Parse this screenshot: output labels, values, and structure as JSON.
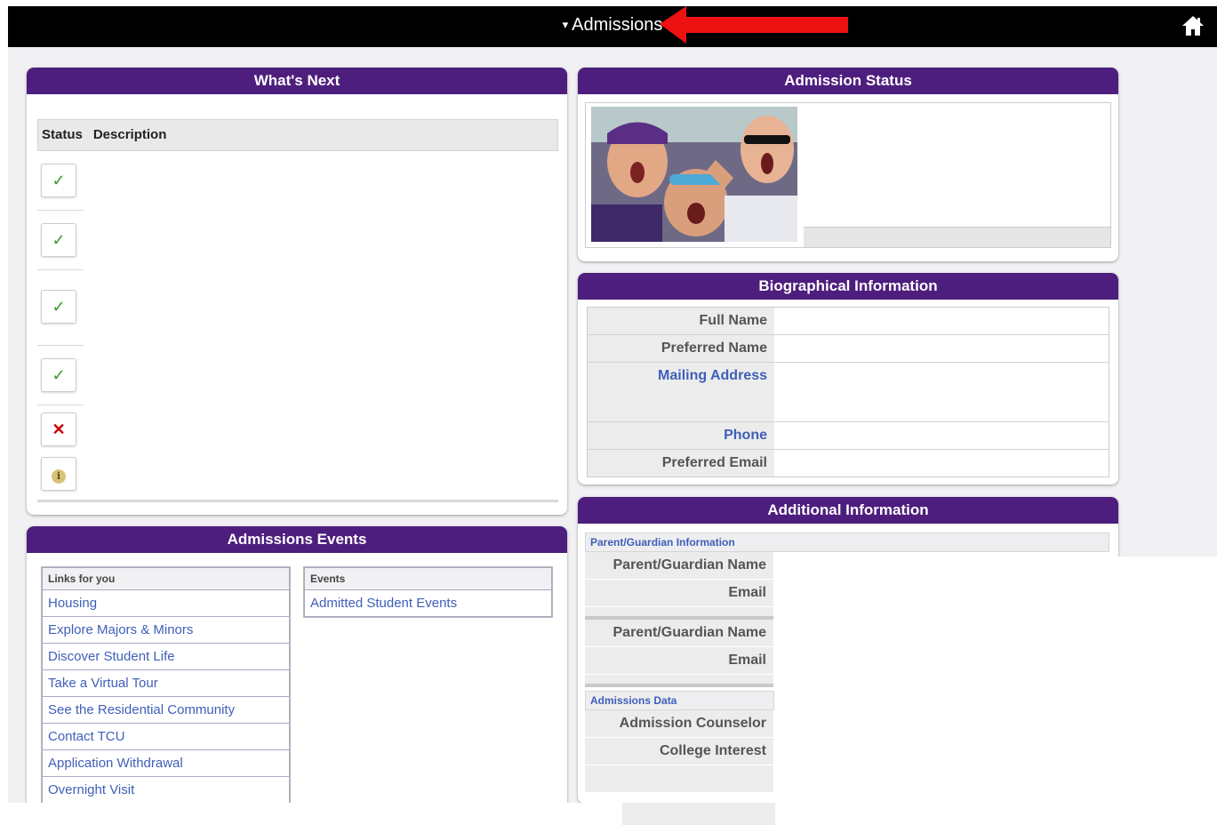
{
  "header": {
    "title": "Admissions",
    "caret": "▾"
  },
  "whats_next": {
    "title": "What's Next",
    "columns": [
      "Status",
      "Description"
    ],
    "rows": [
      {
        "status": "complete",
        "glyph": "✓"
      },
      {
        "status": "complete",
        "glyph": "✓"
      },
      {
        "status": "complete",
        "glyph": "✓"
      },
      {
        "status": "complete",
        "glyph": "✓"
      },
      {
        "status": "incomplete",
        "glyph": "✕"
      },
      {
        "status": "info",
        "glyph": "i"
      }
    ]
  },
  "admission_status": {
    "title": "Admission Status"
  },
  "bio": {
    "title": "Biographical Information",
    "fields": [
      "Full Name",
      "Preferred Name",
      "Mailing Address",
      "Phone",
      "Preferred Email"
    ]
  },
  "additional": {
    "title": "Additional Information",
    "parent_heading": "Parent/Guardian Information",
    "parent1": {
      "name_label": "Parent/Guardian Name",
      "email_label": "Email"
    },
    "parent2": {
      "name_label": "Parent/Guardian Name",
      "email_label": "Email"
    },
    "data_heading": "Admissions Data",
    "counselor_label": "Admission Counselor",
    "college_label": "College Interest"
  },
  "events": {
    "title": "Admissions Events",
    "links_heading": "Links for you",
    "links": [
      "Housing",
      "Explore Majors & Minors",
      "Discover Student Life",
      "Take a Virtual Tour",
      "See the Residential Community",
      "Contact TCU",
      "Application Withdrawal",
      "Overnight Visit"
    ],
    "events_heading": "Events",
    "events_links": [
      "Admitted Student Events"
    ]
  },
  "colors": {
    "header_purple": "#4e1e7e",
    "link_blue": "#3f5fb8",
    "annotation_red": "#ee1111"
  },
  "icons": [
    "home-icon",
    "check-icon",
    "x-icon",
    "info-icon",
    "red-arrow"
  ]
}
